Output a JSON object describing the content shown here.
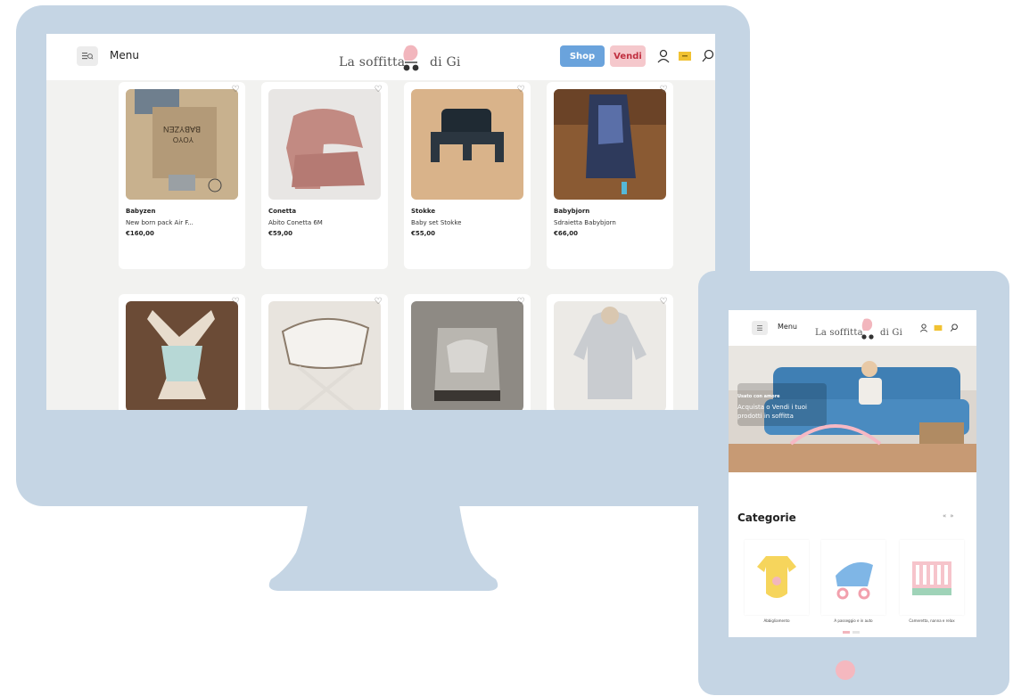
{
  "colors": {
    "device_frame": "#c5d5e4",
    "shop_button": "#6aa3dc",
    "vendi_button": "#f5c8cc",
    "accent_pink": "#f5b8bf",
    "cart_yellow": "#f1c232"
  },
  "desktop": {
    "header": {
      "menu_icon": "menu-search-icon",
      "menu_label": "Menu",
      "logo_before": "La soffitta",
      "logo_after": "di Gi",
      "shop_label": "Shop",
      "vendi_label": "Vendi",
      "icons": [
        "user-icon",
        "cart-icon",
        "search-icon"
      ]
    },
    "products": [
      {
        "brand": "Babyzen",
        "title": "New born pack Air F...",
        "price": "€160,00"
      },
      {
        "brand": "Conetta",
        "title": "Abito Conetta 6M",
        "price": "€59,00"
      },
      {
        "brand": "Stokke",
        "title": "Baby set Stokke",
        "price": "€55,00"
      },
      {
        "brand": "Babybjorn",
        "title": "Sdraietta Babybjorn",
        "price": "€66,00"
      },
      {
        "brand": "",
        "title": "",
        "price": ""
      },
      {
        "brand": "",
        "title": "",
        "price": ""
      },
      {
        "brand": "",
        "title": "",
        "price": ""
      },
      {
        "brand": "",
        "title": "",
        "price": ""
      }
    ],
    "product_image_text": {
      "box_brand": "BABYZEN",
      "box_model": "YOYO"
    }
  },
  "tablet": {
    "header": {
      "menu_label": "Menu",
      "logo_before": "La soffitta",
      "logo_after": "di Gi",
      "icons": [
        "user-icon",
        "cart-icon",
        "search-icon"
      ]
    },
    "hero": {
      "kicker": "Usato con amore",
      "headline": "Acquista o Vendi i tuoi prodotti in soffitta"
    },
    "categories": {
      "title": "Categorie",
      "prev": "«",
      "next": "»",
      "items": [
        {
          "label": "Abbigliamento",
          "icon": "onesie-icon"
        },
        {
          "label": "A passeggio e in auto",
          "icon": "stroller-icon"
        },
        {
          "label": "Cameretta, nanna e relax",
          "icon": "crib-icon"
        }
      ]
    }
  }
}
